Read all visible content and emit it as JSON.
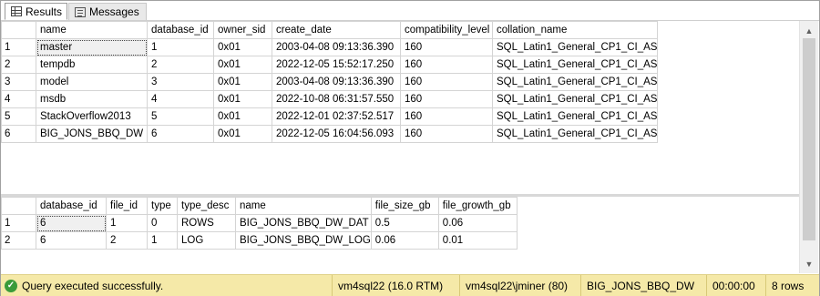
{
  "tabs": {
    "results": "Results",
    "messages": "Messages"
  },
  "grid1": {
    "columns": [
      "name",
      "database_id",
      "owner_sid",
      "create_date",
      "compatibility_level",
      "collation_name"
    ],
    "rows": [
      [
        "1",
        "master",
        "1",
        "0x01",
        "2003-04-08 09:13:36.390",
        "160",
        "SQL_Latin1_General_CP1_CI_AS"
      ],
      [
        "2",
        "tempdb",
        "2",
        "0x01",
        "2022-12-05 15:52:17.250",
        "160",
        "SQL_Latin1_General_CP1_CI_AS"
      ],
      [
        "3",
        "model",
        "3",
        "0x01",
        "2003-04-08 09:13:36.390",
        "160",
        "SQL_Latin1_General_CP1_CI_AS"
      ],
      [
        "4",
        "msdb",
        "4",
        "0x01",
        "2022-10-08 06:31:57.550",
        "160",
        "SQL_Latin1_General_CP1_CI_AS"
      ],
      [
        "5",
        "StackOverflow2013",
        "5",
        "0x01",
        "2022-12-01 02:37:52.517",
        "160",
        "SQL_Latin1_General_CP1_CI_AS"
      ],
      [
        "6",
        "BIG_JONS_BBQ_DW",
        "6",
        "0x01",
        "2022-12-05 16:04:56.093",
        "160",
        "SQL_Latin1_General_CP1_CI_AS"
      ]
    ]
  },
  "grid2": {
    "columns": [
      "database_id",
      "file_id",
      "type",
      "type_desc",
      "name",
      "file_size_gb",
      "file_growth_gb"
    ],
    "rows": [
      [
        "1",
        "6",
        "1",
        "0",
        "ROWS",
        "BIG_JONS_BBQ_DW_DAT",
        "0.5",
        "0.06"
      ],
      [
        "2",
        "6",
        "2",
        "1",
        "LOG",
        "BIG_JONS_BBQ_DW_LOG",
        "0.06",
        "0.01"
      ]
    ]
  },
  "status": {
    "message": "Query executed successfully.",
    "server": "vm4sql22 (16.0 RTM)",
    "user": "vm4sql22\\jminer (80)",
    "database": "BIG_JONS_BBQ_DW",
    "elapsed": "00:00:00",
    "rows": "8 rows"
  },
  "colors": {
    "status_bg": "#f5e9a8",
    "success_icon": "#3a9b3a"
  },
  "icons": {
    "results_tab": "grid-icon",
    "messages_tab": "messages-icon",
    "status_ok": "check-circle-icon"
  }
}
